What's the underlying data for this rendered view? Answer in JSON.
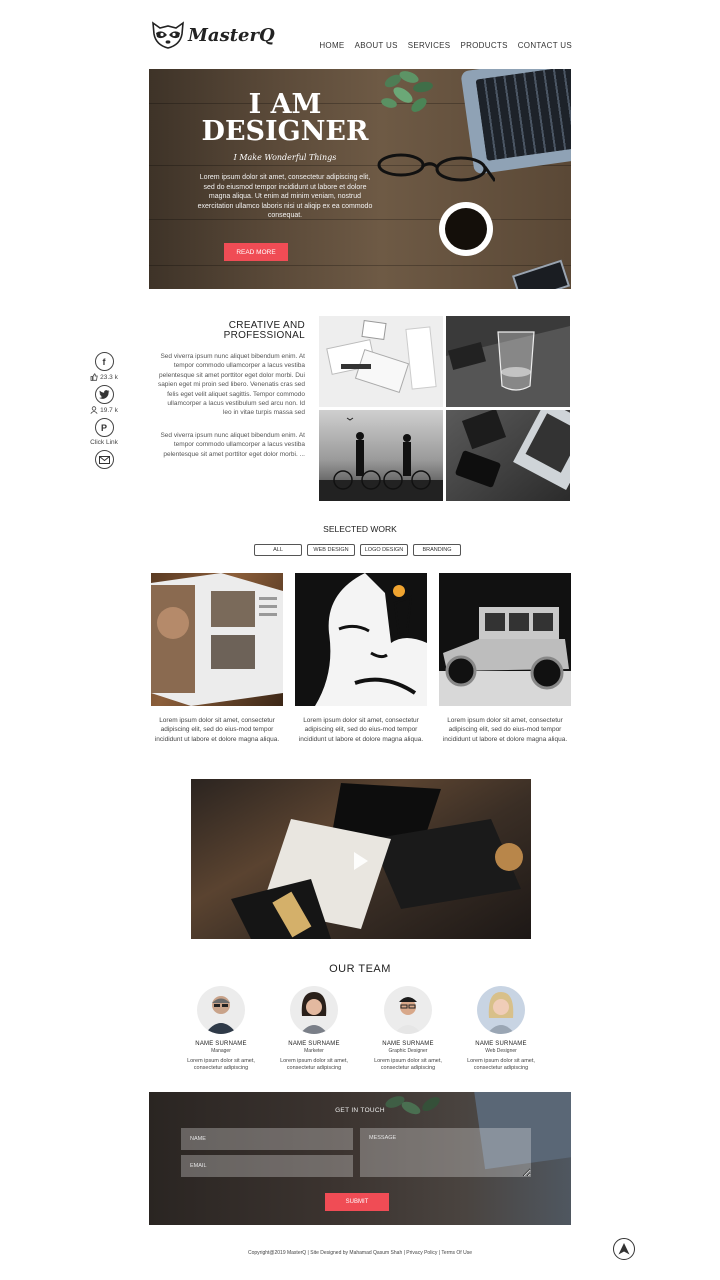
{
  "brand": {
    "name": "MasterQ"
  },
  "nav": {
    "items": [
      "HOME",
      "ABOUT US",
      "SERVICES",
      "PRODUCTS",
      "CONTACT US"
    ]
  },
  "hero": {
    "title_line1": "I AM",
    "title_line2": "DESIGNER",
    "subtitle": "I Make Wonderful Things",
    "text": "Lorem ipsum dolor sit amet, consectetur adipiscing elit, sed do eiusmod tempor incididunt ut labore et dolore magna aliqua. Ut enim ad minim veniam, nostrud exercitation ullamco laboris nisi ut aliqip ex ea commodo consequat.",
    "button": "READ MORE"
  },
  "social": {
    "likes": "23.3 k",
    "followers": "19.7 k",
    "pinterest_label": "Click Link"
  },
  "creative": {
    "title_line1": "CREATIVE AND",
    "title_line2": "PROFESSIONAL",
    "paragraph1": "Sed viverra ipsum nunc aliquet bibendum enim. At tempor commodo ullamcorper a lacus vestiba pelentesque sit amet porttitor eget dolor morbi. Dui sapien eget mi proin sed libero. Venenatis cras sed felis eget velit aliquet sagittis. Tempor commodo ullamcorper a lacus vestibulum sed arcu non. Id leo in vitae turpis massa sed",
    "paragraph2": "Sed viverra ipsum nunc aliquet bibendum enim. At tempor commodo ullamcorper a lacus vestiba pelentesque sit amet porttitor eget dolor morbi. ..."
  },
  "selected_work": {
    "title": "SELECTED WORK",
    "filters": [
      "ALL",
      "WEB DESIGN",
      "LOGO DESIGN",
      "BRANDING"
    ],
    "items": [
      {
        "caption": "Lorem ipsum dolor sit amet, consectetur adipiscing elit, sed do eius-mod tempor incididunt ut labore et dolore magna aliqua."
      },
      {
        "caption": "Lorem ipsum dolor sit amet, consectetur adipiscing elit, sed do eius-mod tempor incididunt ut labore et dolore magna aliqua."
      },
      {
        "caption": "Lorem ipsum dolor sit amet, consectetur adipiscing elit, sed do eius-mod tempor incididunt ut labore et dolore magna aliqua."
      }
    ]
  },
  "team": {
    "title": "OUR TEAM",
    "members": [
      {
        "name": "NAME SURNAME",
        "role": "Manager",
        "desc": "Lorem ipsum dolor sit amet, consectetur adipiscing"
      },
      {
        "name": "NAME SURNAME",
        "role": "Marketer",
        "desc": "Lorem ipsum dolor sit amet, consectetur adipiscing"
      },
      {
        "name": "NAME SURNAME",
        "role": "Graphic Designer",
        "desc": "Lorem ipsum dolor sit amet, consectetur adipiscing"
      },
      {
        "name": "NAME SURNAME",
        "role": "Web Designer",
        "desc": "Lorem ipsum dolor sit amet, consectetur adipiscing"
      }
    ]
  },
  "contact": {
    "title": "GET IN TOUCH",
    "name_placeholder": "NAME",
    "email_placeholder": "EMAIL",
    "message_placeholder": "MESSAGE",
    "submit": "SUBMIT"
  },
  "footer": {
    "text": "Copyright@2019 MasterQ | Site Designed by Mahamad Qasum Shah | Privacy Policy | Terms Of Use"
  },
  "colors": {
    "accent": "#f04c55",
    "text": "#333333"
  }
}
